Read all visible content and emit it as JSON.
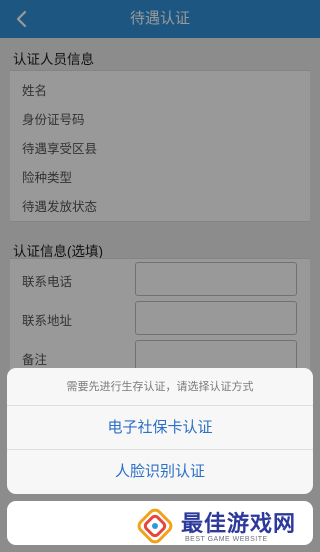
{
  "header": {
    "title": "待遇认证",
    "back_icon": "chevron-left-icon"
  },
  "personal_section": {
    "title": "认证人员信息",
    "fields": [
      "姓名",
      "身份证号码",
      "待遇享受区县",
      "险种类型",
      "待遇发放状态"
    ]
  },
  "optional_section": {
    "title": "认证信息(选填)",
    "fields": [
      "联系电话",
      "联系地址",
      "备注"
    ]
  },
  "action_sheet": {
    "message": "需要先进行生存认证，请选择认证方式",
    "options": [
      "电子社保卡认证",
      "人脸识别认证"
    ]
  },
  "watermark": {
    "title": "最佳游戏网",
    "subtitle": "BEST GAME WEBSITE"
  },
  "colors": {
    "header_bg": "#2f8fd8",
    "sheet_text": "#2b6fc8",
    "watermark": "#2d3a9c"
  }
}
